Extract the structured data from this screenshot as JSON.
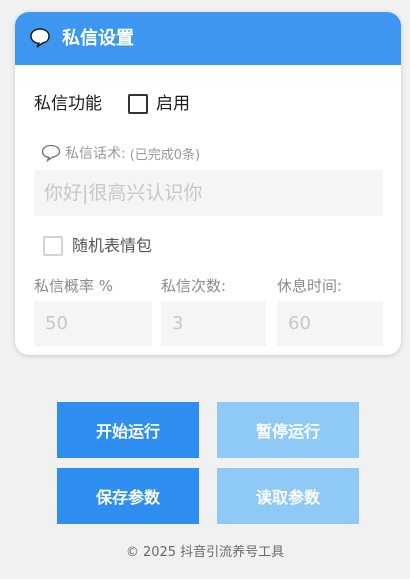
{
  "header": {
    "title": "私信设置",
    "icon": "speech-bubble-icon",
    "color": "#3d97f1"
  },
  "enable_row": {
    "label": "私信功能",
    "checkbox_label": "启用",
    "checked": false
  },
  "script": {
    "label": "私信话术:",
    "count_text": "(已完成0条)",
    "input_value": "你好|很高兴认识你"
  },
  "random_emoji": {
    "label": "随机表情包",
    "checked": false
  },
  "fields": {
    "rate": {
      "label": "私信概率 %",
      "value": "50"
    },
    "times": {
      "label": "私信次数:",
      "value": "3"
    },
    "rest": {
      "label": "休息时间:",
      "value": "60"
    }
  },
  "buttons": {
    "start": "开始运行",
    "pause": "暂停运行",
    "save": "保存参数",
    "load": "读取参数",
    "primary_color": "#2f8ff1",
    "light_color": "#8fc9f5"
  },
  "footer": "© 2025 抖音引流养号工具"
}
